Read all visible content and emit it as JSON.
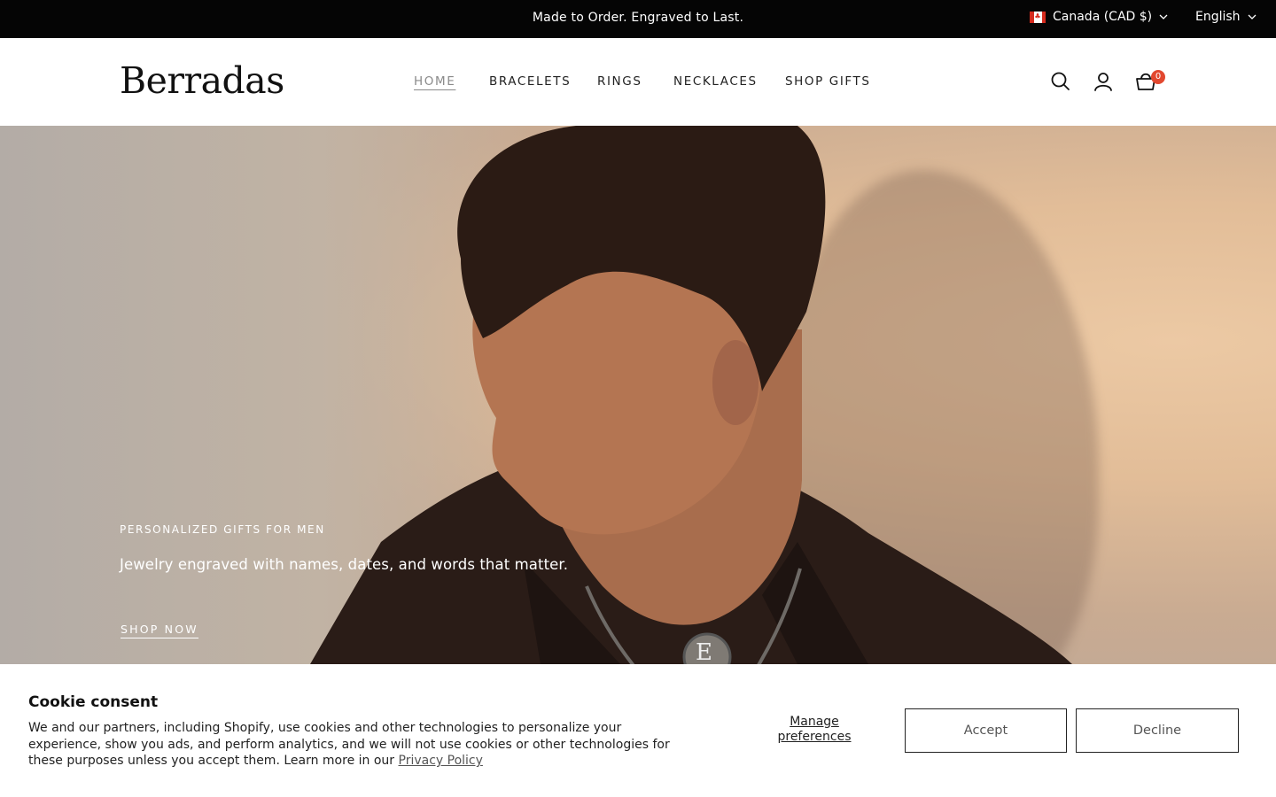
{
  "announcement": {
    "text": "Made to Order. Engraved to Last.",
    "country": "Canada (CAD $)",
    "language": "English"
  },
  "header": {
    "logo": "Berradas",
    "nav": [
      "HOME",
      "BRACELETS",
      "RINGS",
      "NECKLACES",
      "SHOP GIFTS"
    ],
    "active_nav": "HOME",
    "cart_count": "0",
    "icons": [
      "search-icon",
      "account-icon",
      "cart-icon"
    ]
  },
  "hero": {
    "title": "PERSONALIZED GIFTS FOR MEN",
    "subtitle": "Jewelry engraved with names, dates, and words that matter.",
    "cta": "SHOP NOW",
    "pendant_letter": "E"
  },
  "cookie": {
    "title": "Cookie consent",
    "text": "We and our partners, including Shopify, use cookies and other technologies to personalize your experience, show you ads, and perform analytics, and we will not use cookies or other technologies for these purposes unless you accept them. Learn more in our",
    "link": "Privacy Policy",
    "manage": "Manage preferences",
    "accept": "Accept",
    "decline": "Decline"
  },
  "colors": {
    "announcement_bg": "#050505",
    "cart_badge": "#e2482f",
    "nav_active": "#8a8a8a"
  }
}
